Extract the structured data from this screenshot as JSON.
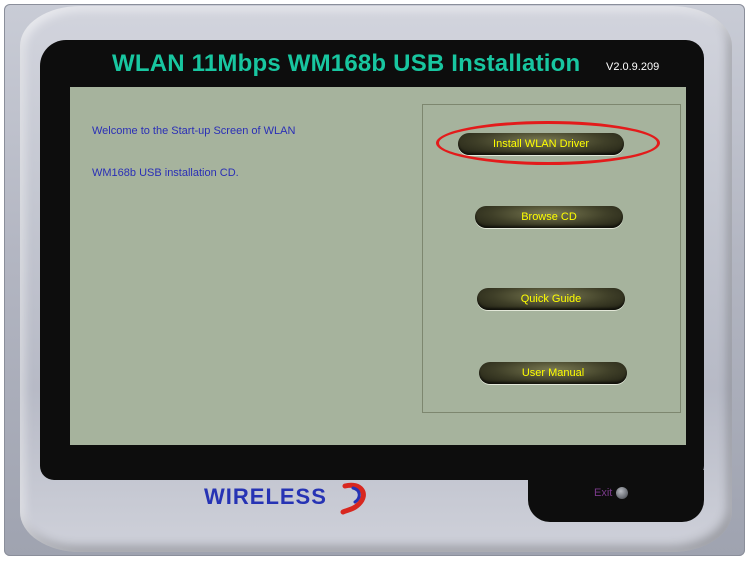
{
  "window": {
    "title": "WLAN  11Mbps WM168b USB Installation",
    "version": "V2.0.9.209"
  },
  "welcome": {
    "line1": "Welcome to the Start-up Screen of WLAN",
    "line2": "WM168b USB installation  CD."
  },
  "menu": {
    "install_driver": "Install WLAN Driver",
    "browse_cd": "Browse CD",
    "quick_guide": "Quick Guide",
    "user_manual": "User Manual"
  },
  "footer": {
    "logo_text": "WIRELESS",
    "exit_label": "Exit"
  },
  "icons": {
    "exit": "exit-button-icon",
    "logo": "wireless-swirl-icon"
  },
  "colors": {
    "title": "#18c6a0",
    "content_bg": "#a6b39d",
    "button_text": "#ffff00",
    "highlight": "#e31b1b",
    "logo": "#2633b4",
    "exit": "#7a3a8a"
  }
}
